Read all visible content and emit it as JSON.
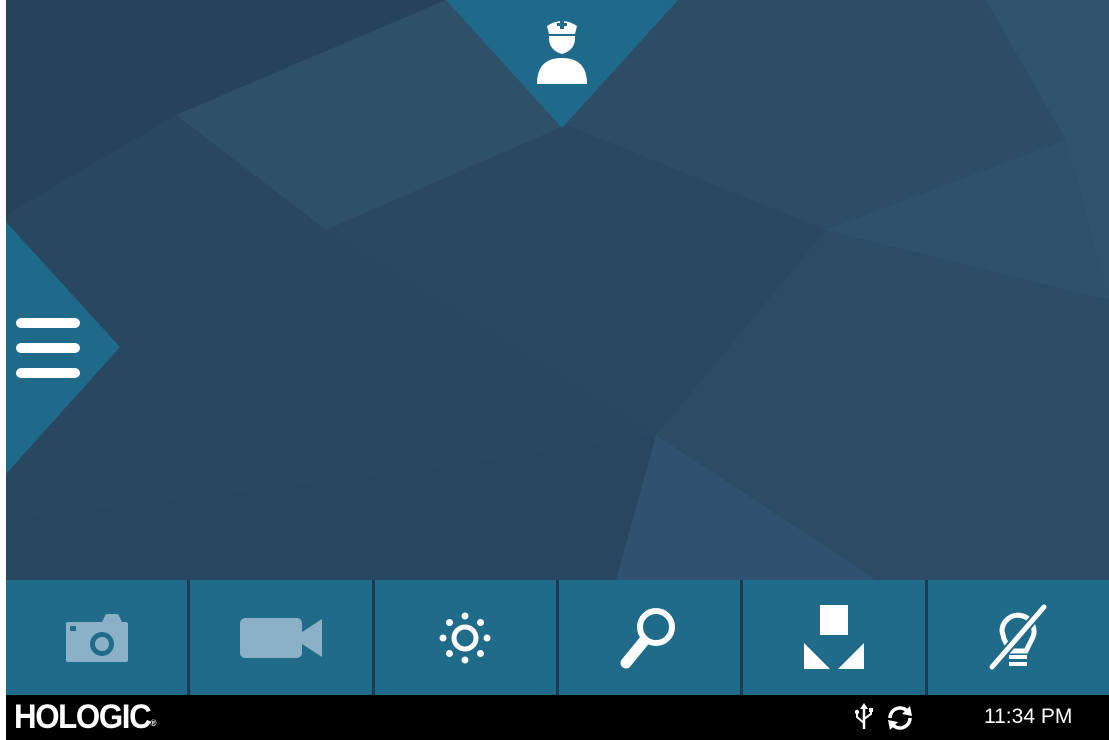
{
  "app": {
    "brand": "HOLOGIC",
    "brand_mark": "®"
  },
  "top_tab": {
    "icon": "nurse-icon"
  },
  "side_tab": {
    "icon": "menu-icon"
  },
  "toolbar": {
    "buttons": [
      {
        "icon": "camera-icon",
        "enabled": false
      },
      {
        "icon": "video-camera-icon",
        "enabled": false
      },
      {
        "icon": "brightness-icon",
        "enabled": true
      },
      {
        "icon": "magnify-icon",
        "enabled": true
      },
      {
        "icon": "capture-download-icon",
        "enabled": true
      },
      {
        "icon": "light-off-icon",
        "enabled": true
      }
    ]
  },
  "status": {
    "usb_icon": "usb-icon",
    "sync_icon": "sync-icon",
    "time": "11:34 PM"
  },
  "colors": {
    "background": "#2a4a63",
    "accent": "#1f6a8b",
    "toolbar_button": "#206a8a",
    "disabled_icon": "#8ab1c6",
    "icon": "#ffffff",
    "status_bar": "#000000"
  }
}
